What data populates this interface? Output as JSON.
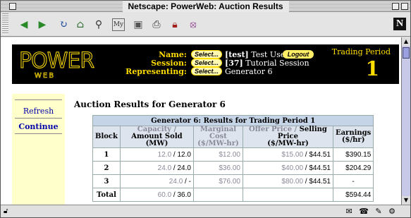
{
  "window": {
    "title": "Netscape: PowerWeb: Auction Results"
  },
  "toolbar": {
    "icons": [
      "back-icon",
      "forward-icon",
      "reload-icon",
      "home-icon",
      "search-icon",
      "mynetscape-icon",
      "images-icon",
      "print-icon",
      "security-icon",
      "stop-icon"
    ],
    "logo": "N"
  },
  "banner": {
    "logo_top": "POWER",
    "logo_bottom": "WEB",
    "name_label": "Name:",
    "session_label": "Session:",
    "representing_label": "Representing:",
    "select_label": "Select...",
    "name_tag": "[test]",
    "name_value": "Test User",
    "logout_label": "Logout",
    "session_tag": "[37]",
    "session_value": "Tutorial Session",
    "representing_value": "Generator 6",
    "trading_period_label": "Trading Period",
    "trading_period_value": "1"
  },
  "nav": {
    "refresh": "Refresh",
    "continue": "Continue"
  },
  "page": {
    "heading": "Auction Results for Generator 6"
  },
  "table": {
    "caption": "Generator 6: Results for Trading Period 1",
    "headers": {
      "block": "Block",
      "capacity": "Capacity /",
      "amount_sold": "Amount Sold",
      "mw": "(MW)",
      "marginal_cost": "Marginal Cost",
      "mc_unit": "($/MW-hr)",
      "offer_price": "Offer Price /",
      "selling_price": "Selling Price",
      "price_unit": "($/MW-hr)",
      "earnings": "Earnings",
      "earnings_unit": "($/hr)"
    },
    "rows": [
      {
        "block": "1",
        "capacity": "12.0",
        "sold": "12.0",
        "marginal_cost": "$12.00",
        "offer": "$15.00",
        "selling": "$44.51",
        "earnings": "$390.15"
      },
      {
        "block": "2",
        "capacity": "24.0",
        "sold": "24.0",
        "marginal_cost": "$36.00",
        "offer": "$40.00",
        "selling": "$44.51",
        "earnings": "$204.29"
      },
      {
        "block": "3",
        "capacity": "24.0",
        "sold": "-",
        "marginal_cost": "$76.00",
        "offer": "$80.00",
        "selling": "$44.51",
        "earnings": "-"
      }
    ],
    "total": {
      "label": "Total",
      "capacity": "60.0",
      "sold": "36.0",
      "earnings": "$594.44"
    },
    "slash": "/"
  }
}
